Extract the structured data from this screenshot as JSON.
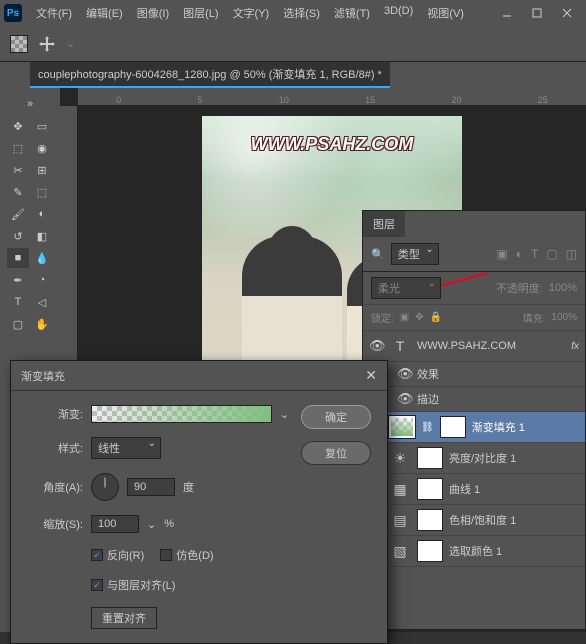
{
  "menu": {
    "file": "文件(F)",
    "edit": "编辑(E)",
    "image": "图像(I)",
    "layer": "图层(L)",
    "type": "文字(Y)",
    "select": "选择(S)",
    "filter": "滤镜(T)",
    "threed": "3D(D)",
    "view": "视图(V)"
  },
  "ps_logo": "Ps",
  "doc_tab": "couplephotography-6004268_1280.jpg @ 50% (渐变填充 1, RGB/8#) *",
  "ruler_h": [
    "0",
    "5",
    "10",
    "15",
    "20",
    "25"
  ],
  "watermark": "WWW.PSAHZ.COM",
  "layers_panel": {
    "title": "图层",
    "search": "类型",
    "blend": "柔光",
    "opacity_label": "不透明度:",
    "opacity_value": "100%",
    "lock_label": "锁定:",
    "fill_label": "填充:",
    "fill_value": "100%",
    "fx_label": "fx",
    "layers": [
      {
        "type": "T",
        "name": "WWW.PSAHZ.COM"
      },
      {
        "type": "fx",
        "name": "效果"
      },
      {
        "type": "fx_item",
        "name": "描边"
      },
      {
        "type": "grad",
        "name": "渐变填充 1"
      },
      {
        "type": "adj",
        "icon": "☀",
        "name": "亮度/对比度 1"
      },
      {
        "type": "adj",
        "icon": "▦",
        "name": "曲线 1"
      },
      {
        "type": "adj",
        "icon": "▤",
        "name": "色相/饱和度 1"
      },
      {
        "type": "adj",
        "icon": "▧",
        "name": "选取颜色 1"
      }
    ]
  },
  "dialog": {
    "title": "渐变填充",
    "ok": "确定",
    "reset": "复位",
    "gradient_label": "渐变:",
    "style_label": "样式:",
    "style_value": "线性",
    "angle_label": "角度(A):",
    "angle_value": "90",
    "angle_unit": "度",
    "scale_label": "缩放(S):",
    "scale_value": "100",
    "scale_unit": "%",
    "reverse": "反向(R)",
    "dither": "仿色(D)",
    "align": "与图层对齐(L)",
    "reset_align": "重置对齐"
  }
}
